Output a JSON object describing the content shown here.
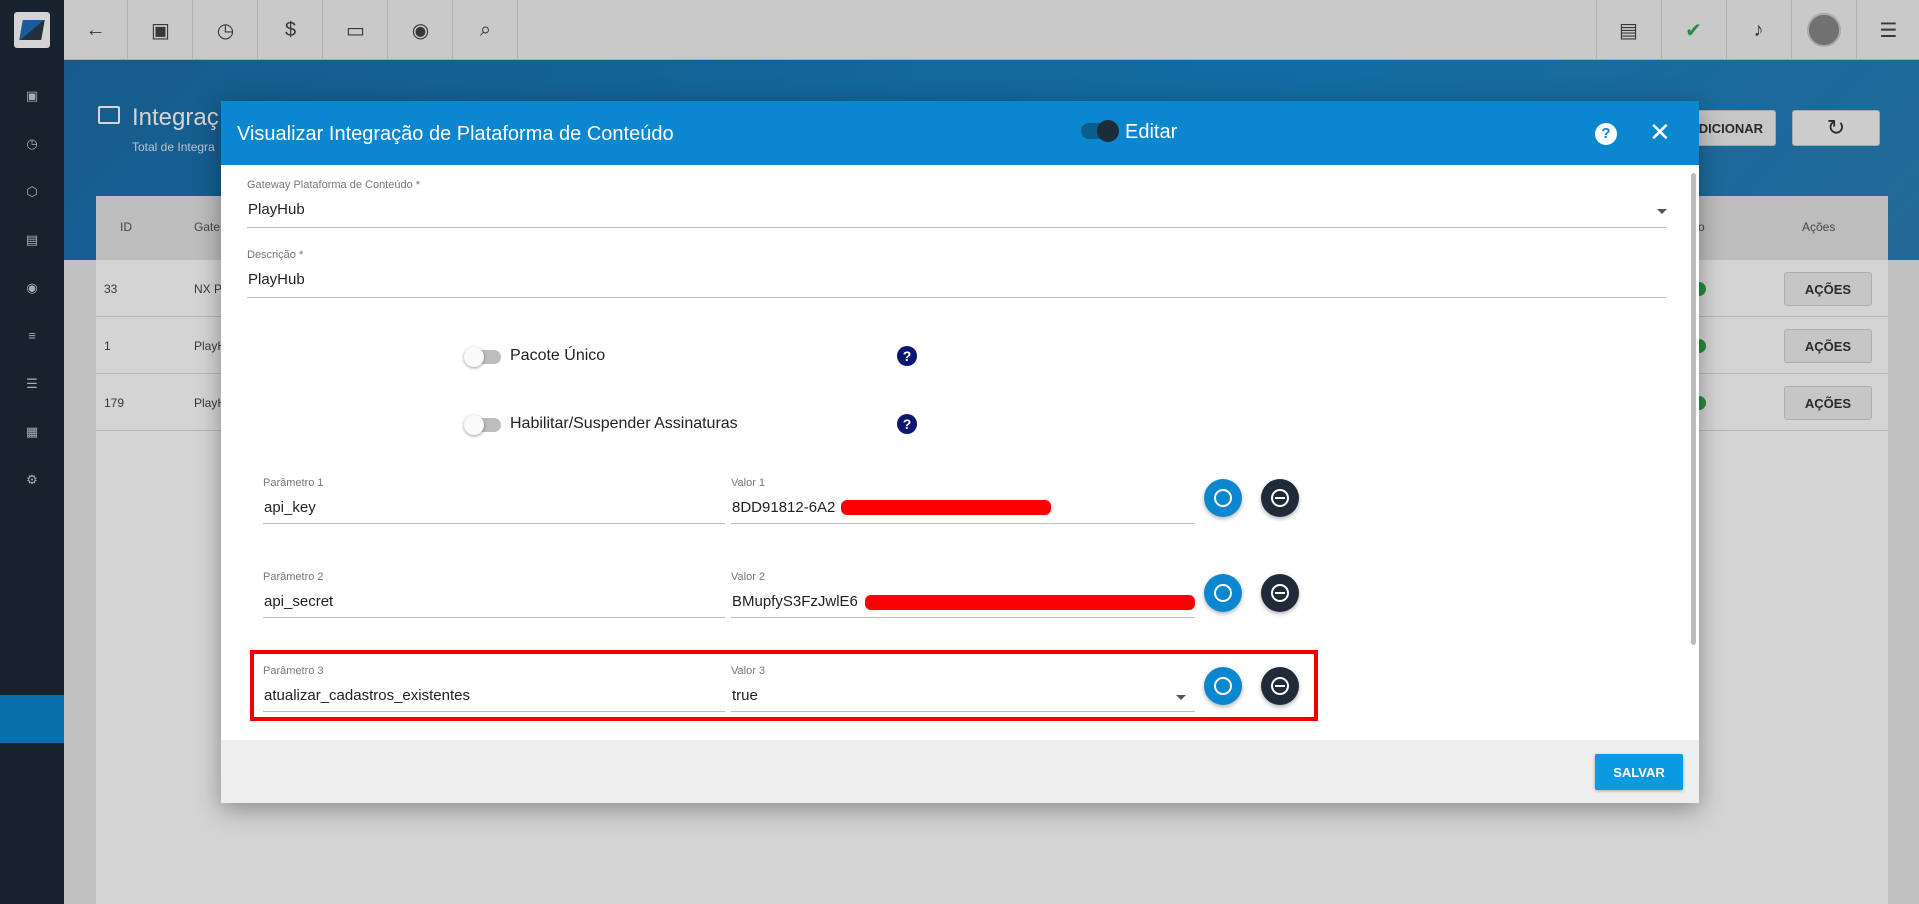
{
  "topbar": {
    "left_icons": [
      "back-arrow-icon",
      "contact-card-icon",
      "calendar-clock-icon",
      "dollar-icon",
      "terminal-icon",
      "eye-icon",
      "search-icon"
    ],
    "right_icons": [
      "pdf-icon",
      "check-message-icon",
      "bell-icon",
      "avatar",
      "menu-list-icon"
    ]
  },
  "page": {
    "title": "Integraç",
    "subtitle": "Total de Integra",
    "add_button": "ADICIONAR"
  },
  "table": {
    "headers": {
      "id": "ID",
      "gateway": "Gate",
      "ativo": "vo",
      "acoes": "Ações"
    },
    "rows": [
      {
        "id": "33",
        "gateway": "NX P",
        "acoes": "AÇÕES"
      },
      {
        "id": "1",
        "gateway": "PlayH",
        "acoes": "AÇÕES"
      },
      {
        "id": "179",
        "gateway": "PlayH",
        "acoes": "AÇÕES"
      }
    ]
  },
  "modal": {
    "title": "Visualizar Integração de Plataforma de Conteúdo",
    "edit_label": "Editar",
    "gateway_label": "Gateway Plataforma de Conteúdo *",
    "gateway_value": "PlayHub",
    "descricao_label": "Descrição *",
    "descricao_value": "PlayHub",
    "toggle_pacote": "Pacote Único",
    "toggle_habilitar": "Habilitar/Suspender Assinaturas",
    "params": [
      {
        "param_label": "Parâmetro 1",
        "param_value": "api_key",
        "valor_label": "Valor 1",
        "valor_value": "8DD91812-6A2"
      },
      {
        "param_label": "Parâmetro 2",
        "param_value": "api_secret",
        "valor_label": "Valor 2",
        "valor_value": "BMupfyS3FzJwlE6"
      },
      {
        "param_label": "Parâmetro 3",
        "param_value": "atualizar_cadastros_existentes",
        "valor_label": "Valor 3",
        "valor_value": "true"
      }
    ],
    "save_button": "SALVAR"
  },
  "colors": {
    "primary": "#0b87d0",
    "sidebar": "#1d2a36",
    "highlight": "#ee0000"
  }
}
